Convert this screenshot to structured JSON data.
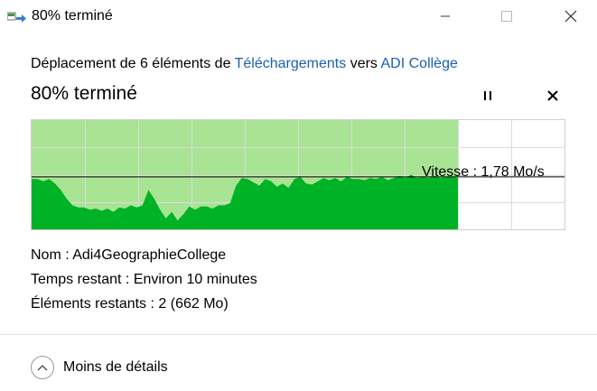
{
  "window": {
    "title": "80% terminé",
    "icon": "file-move-icon"
  },
  "operation": {
    "prefix": "Déplacement de 6 éléments de",
    "source": "Téléchargements",
    "middle": "vers",
    "destination": "ADI Collège"
  },
  "progress": {
    "title": "80% terminé",
    "percent": 80
  },
  "graph": {
    "speed_label": "Vitesse : 1,78 Mo/s",
    "fill_color": "#a8e494",
    "line_color": "#00b226",
    "speed_samples": [
      0.46,
      0.46,
      0.44,
      0.46,
      0.42,
      0.36,
      0.28,
      0.22,
      0.2,
      0.2,
      0.18,
      0.19,
      0.17,
      0.19,
      0.16,
      0.2,
      0.19,
      0.22,
      0.2,
      0.22,
      0.36,
      0.28,
      0.18,
      0.1,
      0.16,
      0.08,
      0.14,
      0.21,
      0.18,
      0.21,
      0.21,
      0.19,
      0.22,
      0.22,
      0.24,
      0.4,
      0.47,
      0.46,
      0.43,
      0.4,
      0.46,
      0.44,
      0.39,
      0.42,
      0.38,
      0.46,
      0.48,
      0.42,
      0.41,
      0.44,
      0.47,
      0.45,
      0.47,
      0.44,
      0.48,
      0.46,
      0.46,
      0.45,
      0.47,
      0.46,
      0.48,
      0.45,
      0.47,
      0.49,
      0.47,
      0.5,
      0.47,
      0.48,
      0.47,
      0.49,
      0.47,
      0.48,
      0.48,
      0.47
    ],
    "avg_speed": 0.48
  },
  "details": {
    "name_label": "Nom :",
    "name_value": "Adi4GeographieCollege",
    "time_label": "Temps restant :",
    "time_value": "Environ 10 minutes",
    "items_label": "Éléments restants :",
    "items_value": "2 (662 Mo)"
  },
  "footer": {
    "toggle_label": "Moins de détails"
  }
}
